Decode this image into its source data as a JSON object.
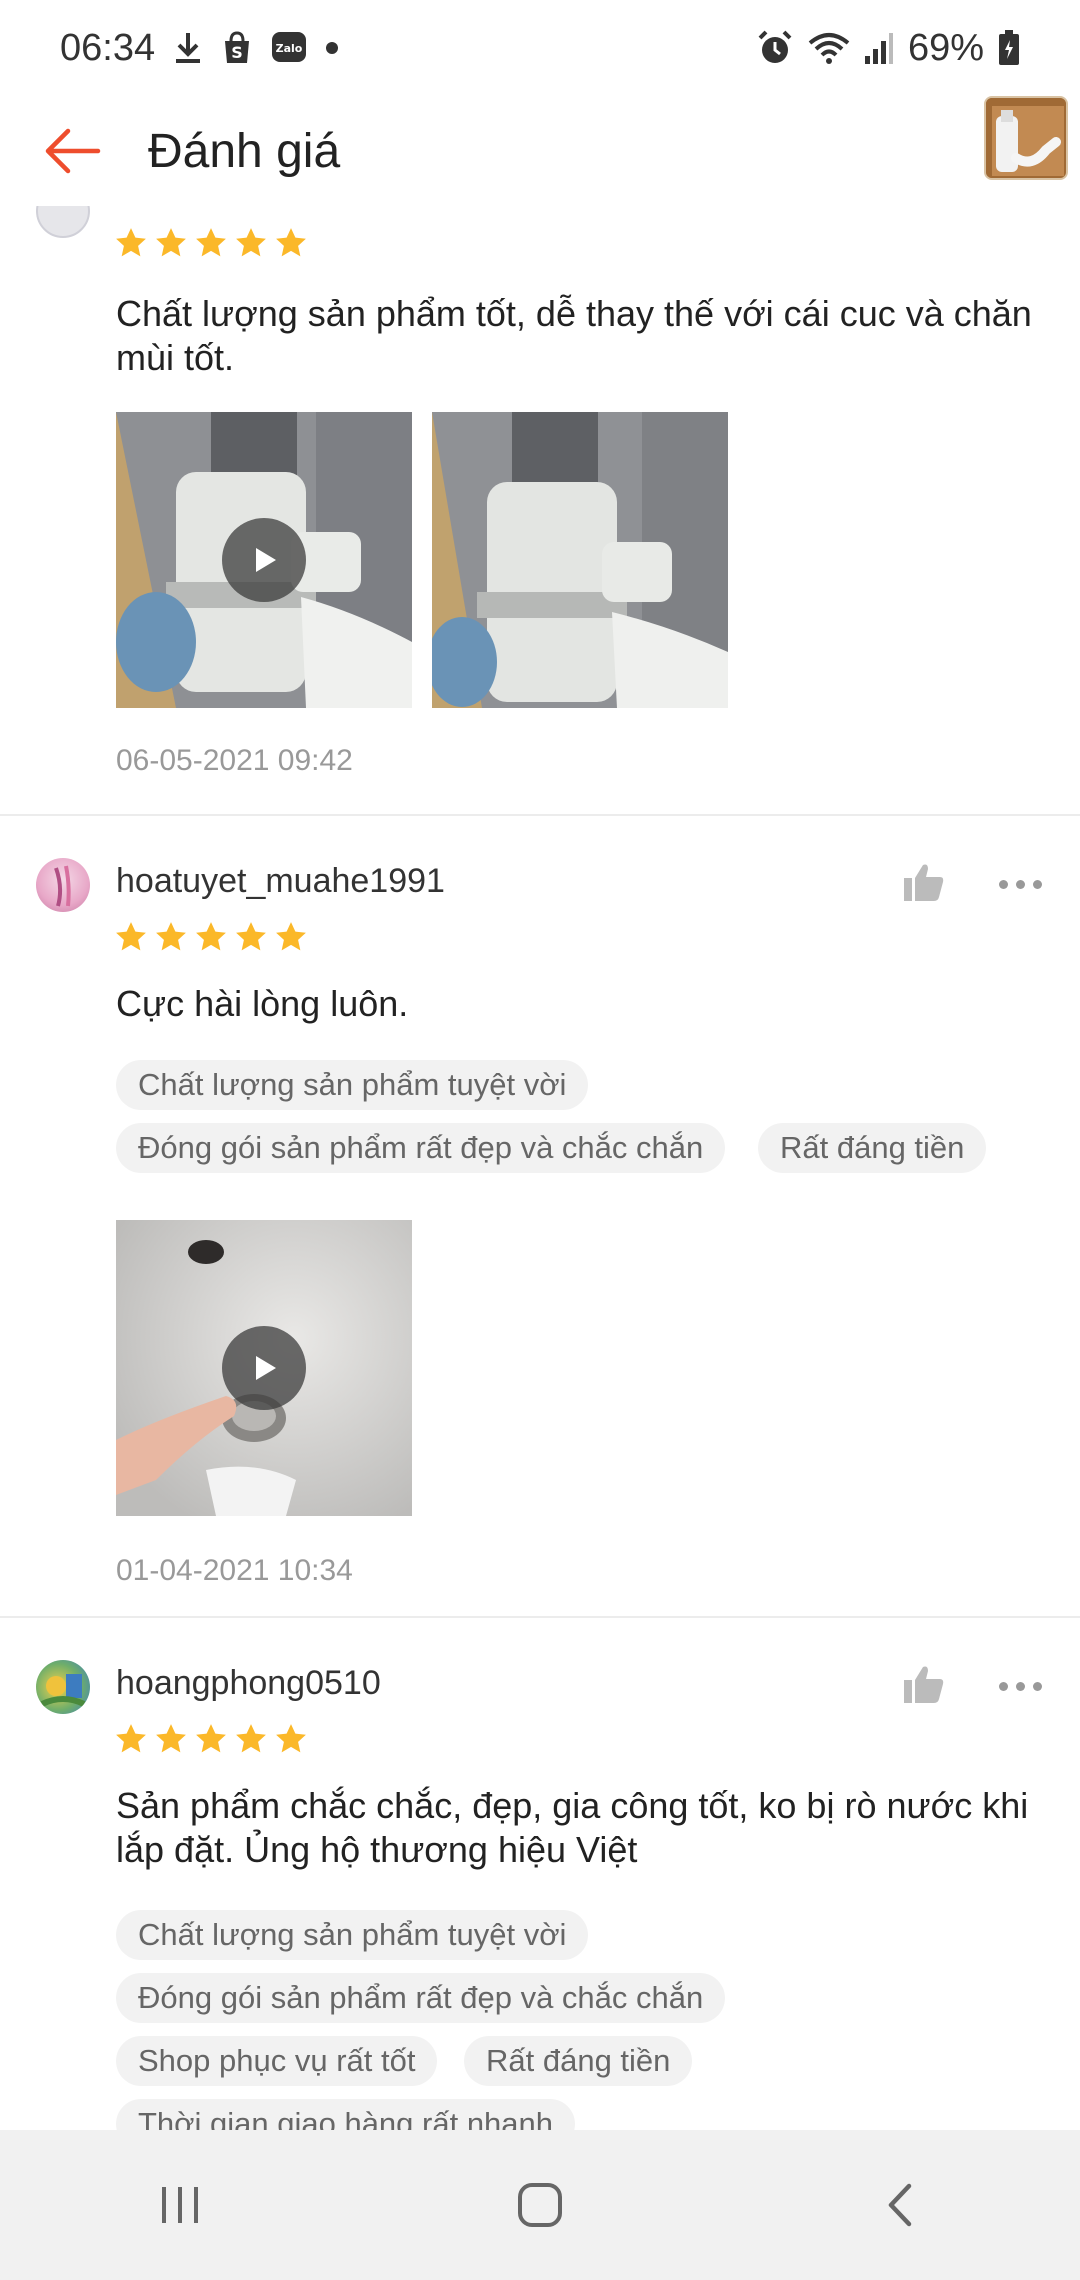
{
  "status_bar": {
    "time": "06:34",
    "battery": "69%",
    "icons": [
      "download-icon",
      "shopee-icon",
      "zalo-icon",
      "dot-icon",
      "alarm-icon",
      "wifi-icon",
      "signal-icon",
      "battery-icon"
    ],
    "zalo_label": "Zalo"
  },
  "header": {
    "title": "Đánh giá",
    "back_icon": "back-arrow-icon",
    "accent": "#ee4d2d"
  },
  "reviews": [
    {
      "rating": 5,
      "text": "Chất lượng sản phẩm tốt, dễ thay thế với cái cuc và chăn mùi tốt.",
      "media": [
        "video-thumb",
        "image-thumb"
      ],
      "date": "06-05-2021 09:42"
    },
    {
      "username": "hoatuyet_muahe1991",
      "rating": 5,
      "text": "Cực hài lòng luôn.",
      "tags": [
        "Chất lượng sản phẩm tuyệt vời",
        "Đóng gói sản phẩm rất đẹp và chắc chắn",
        "Rất đáng tiền"
      ],
      "media": [
        "video-thumb"
      ],
      "date": "01-04-2021 10:34"
    },
    {
      "username": "hoangphong0510",
      "rating": 5,
      "text": "Sản phẩm chắc chắc, đẹp, gia công tốt, ko bị rò nước khi lắp đặt. Ủng hộ thương hiệu Việt",
      "tags": [
        "Chất lượng sản phẩm tuyệt vời",
        "Đóng gói sản phẩm rất đẹp và chắc chắn",
        "Shop phục vụ rất tốt",
        "Rất đáng tiền",
        "Thời gian giao hàng rất nhanh"
      ]
    }
  ],
  "colors": {
    "star": "#fbb829",
    "tag_bg": "#f2f2f2",
    "date": "#999999"
  },
  "nav": [
    "recents-icon",
    "home-icon",
    "back-icon"
  ]
}
